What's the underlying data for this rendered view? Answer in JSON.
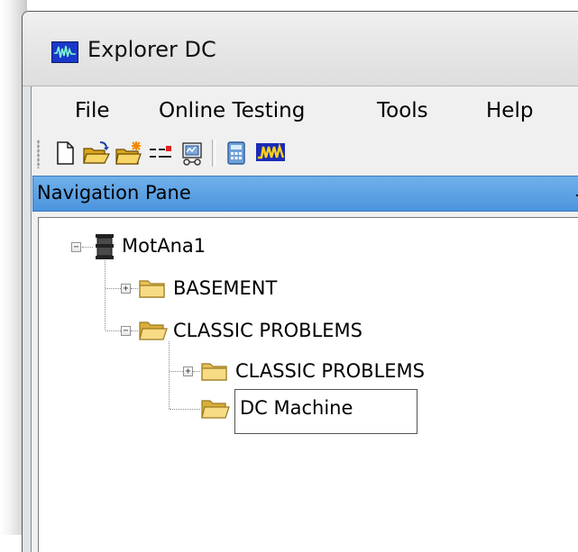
{
  "window": {
    "title": "Explorer DC",
    "app_icon": "waveform-app-icon"
  },
  "menu": {
    "items": [
      "File",
      "Online Testing",
      "Tools",
      "Help"
    ]
  },
  "toolbar": {
    "buttons": [
      {
        "icon": "new-document-icon"
      },
      {
        "icon": "open-folder-icon"
      },
      {
        "icon": "new-folder-icon"
      },
      {
        "icon": "connection-lines-icon"
      },
      {
        "icon": "test-device-icon"
      },
      {
        "icon": "calculator-icon"
      },
      {
        "icon": "waveform-icon"
      }
    ]
  },
  "navigation_pane": {
    "title": "Navigation Pane",
    "pin_icon": "pin-icon"
  },
  "tree": {
    "root": {
      "label": "MotAna1",
      "icon": "machine-icon",
      "expanded": true
    },
    "nodes": [
      {
        "label": "BASEMENT",
        "icon": "folder-icon",
        "level": 1,
        "expanded": false
      },
      {
        "label": "CLASSIC PROBLEMS",
        "icon": "folder-open-icon",
        "level": 1,
        "expanded": true
      },
      {
        "label": "CLASSIC PROBLEMS",
        "icon": "folder-icon",
        "level": 2,
        "expanded": false
      },
      {
        "label": "DC Machine",
        "icon": "folder-open-icon",
        "level": 2,
        "selected": true
      }
    ]
  },
  "colors": {
    "nav_header": "#5aa3e6",
    "window_frame": "#dedede",
    "folder": "#f2d36b"
  }
}
